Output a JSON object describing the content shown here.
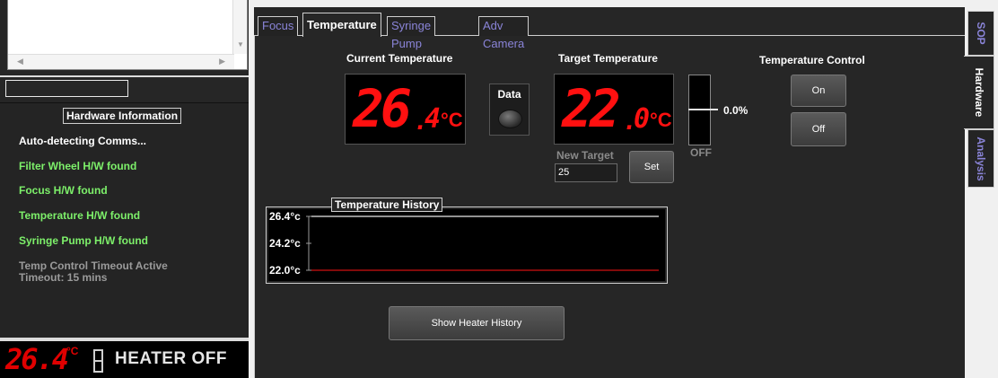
{
  "left_panel": {
    "hardware_info_title": "Hardware Information",
    "log": [
      {
        "text": "Auto-detecting Comms...",
        "color": "#ffffff"
      },
      {
        "text": "Filter Wheel H/W found",
        "color": "#7df06a"
      },
      {
        "text": "Focus H/W found",
        "color": "#7df06a"
      },
      {
        "text": "Temperature H/W found",
        "color": "#7df06a"
      },
      {
        "text": "Syringe Pump H/W found",
        "color": "#7df06a"
      },
      {
        "text": "Temp Control Timeout Active",
        "color": "#9a9a9a"
      },
      {
        "text": "Timeout: 15 mins",
        "color": "#9a9a9a"
      }
    ],
    "status": {
      "temperature": "26.4",
      "unit": "°C",
      "heater_text": "HEATER OFF"
    }
  },
  "tabs": [
    {
      "label": "Focus"
    },
    {
      "label": "Temperature"
    },
    {
      "label": "Syringe Pump"
    },
    {
      "label": "Adv Camera"
    }
  ],
  "active_tab": "Temperature",
  "temperature_panel": {
    "current_label": "Current Temperature",
    "current_int": "26",
    "current_dec": "4",
    "target_label": "Target Temperature",
    "target_int": "22",
    "target_dec": "0",
    "unit": "°C",
    "data_label": "Data",
    "heater_percent": "0.0%",
    "heater_state": "OFF",
    "new_target_label": "New Target",
    "new_target_value": "25",
    "set_label": "Set",
    "control_label": "Temperature Control",
    "on_label": "On",
    "off_label": "Off",
    "history_title": "Temperature History",
    "show_history_label": "Show Heater History"
  },
  "chart_data": {
    "type": "line",
    "title": "Temperature History",
    "y_ticks": [
      "26.4°c",
      "24.2°c",
      "22.0°c"
    ],
    "ylim": [
      22.0,
      26.4
    ],
    "series": [
      {
        "values": [
          26.4,
          26.4
        ],
        "color": "#e8e8e8"
      },
      {
        "values": [
          22.0,
          22.0
        ],
        "color": "#d01010"
      }
    ]
  },
  "right_tabs": [
    {
      "label": "SOP"
    },
    {
      "label": "Hardware"
    },
    {
      "label": "Analysis"
    }
  ],
  "active_right_tab": "Hardware"
}
